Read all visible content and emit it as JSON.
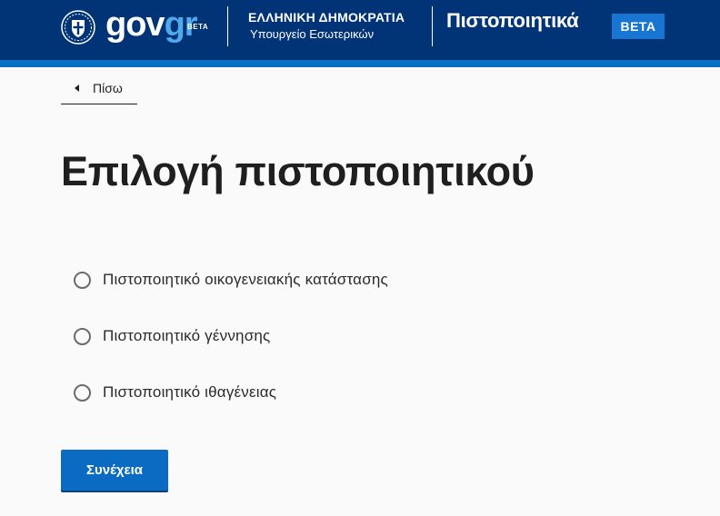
{
  "header": {
    "logo_gov": "gov",
    "logo_gr": "gr",
    "logo_beta": "BETA",
    "ministry_top": "ΕΛΛΗΝΙΚΗ ΔΗΜΟΚΡΑΤΙΑ",
    "ministry_sub": "Υπουργείο Εσωτερικών",
    "service_title": "Πιστοποιητικά",
    "service_beta": "BETA"
  },
  "colors": {
    "header_bg": "#003476",
    "stripe": "#0a6ec5",
    "accent": "#1876d2",
    "button": "#0b6bc3"
  },
  "back": {
    "label": "Πίσω",
    "icon": "chevron-left-icon"
  },
  "page": {
    "title": "Επιλογή πιστοποιητικού"
  },
  "options": [
    {
      "label": "Πιστοποιητικό οικογενειακής κατάστασης",
      "selected": false
    },
    {
      "label": "Πιστοποιητικό γέννησης",
      "selected": false
    },
    {
      "label": "Πιστοποιητικό ιθαγένειας",
      "selected": false
    }
  ],
  "actions": {
    "continue_label": "Συνέχεια"
  }
}
